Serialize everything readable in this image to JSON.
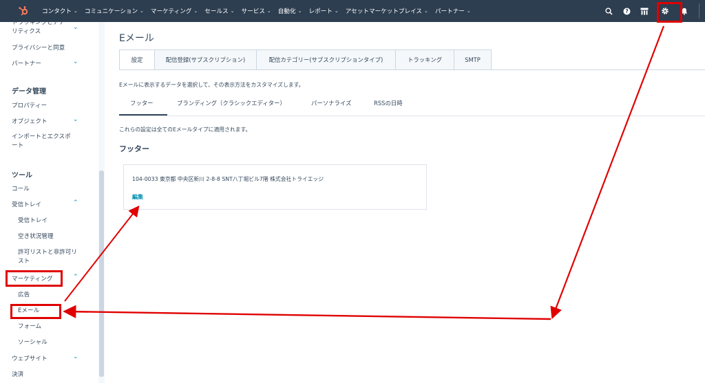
{
  "topnav": {
    "items": [
      {
        "label": "コンタクト"
      },
      {
        "label": "コミュニケーション"
      },
      {
        "label": "マーケティング"
      },
      {
        "label": "セールス"
      },
      {
        "label": "サービス"
      },
      {
        "label": "自動化"
      },
      {
        "label": "レポート"
      },
      {
        "label": "アセットマーケットプレイス"
      },
      {
        "label": "パートナー"
      }
    ],
    "icons": [
      "search-icon",
      "help-icon",
      "marketplace-icon",
      "settings-icon",
      "notifications-icon"
    ],
    "brand_color": "#ff7a59",
    "bg_color": "#2d3e50"
  },
  "sidebar": {
    "items": [
      {
        "label": "トラッキングとアナ\nリティクス"
      },
      {
        "label": "プライバシーと同意"
      },
      {
        "label": "パートナー"
      },
      {
        "label": "データ管理"
      },
      {
        "label": "プロパティー"
      },
      {
        "label": "オブジェクト"
      },
      {
        "label": "インポートとエクスポ\nート"
      },
      {
        "label": "ツール"
      },
      {
        "label": "コール"
      },
      {
        "label": "受信トレイ"
      },
      {
        "label": "受信トレイ"
      },
      {
        "label": "空き状況管理"
      },
      {
        "label": "許可リストと非許可リ\nスト"
      },
      {
        "label": "マーケティング"
      },
      {
        "label": "広告"
      },
      {
        "label": "Eメール"
      },
      {
        "label": "フォーム"
      },
      {
        "label": "ソーシャル"
      },
      {
        "label": "ウェブサイト"
      },
      {
        "label": "決済"
      }
    ]
  },
  "main": {
    "title": "Eメール",
    "tabs": [
      {
        "label": "設定"
      },
      {
        "label": "配信登録(サブスクリプション)"
      },
      {
        "label": "配信カテゴリー(サブスクリプションタイプ)"
      },
      {
        "label": "トラッキング"
      },
      {
        "label": "SMTP"
      }
    ],
    "description": "Eメールに表示するデータを選択して、その表示方法をカスタマイズします。",
    "subtabs": [
      {
        "label": "フッター"
      },
      {
        "label": "ブランディング（クラシックエディター）"
      },
      {
        "label": "パーソナライズ"
      },
      {
        "label": "RSSの日時"
      }
    ],
    "note": "これらの設定は全てのEメールタイプに適用されます。",
    "section_title": "フッター",
    "footer_address": "104-0033 東京都 中央区新川 2-8-8 SNT八丁堀ビル7階 株式会社トライエッジ",
    "edit_label": "編集"
  },
  "annotation_color": "#e00000",
  "link_color": "#0091ae"
}
